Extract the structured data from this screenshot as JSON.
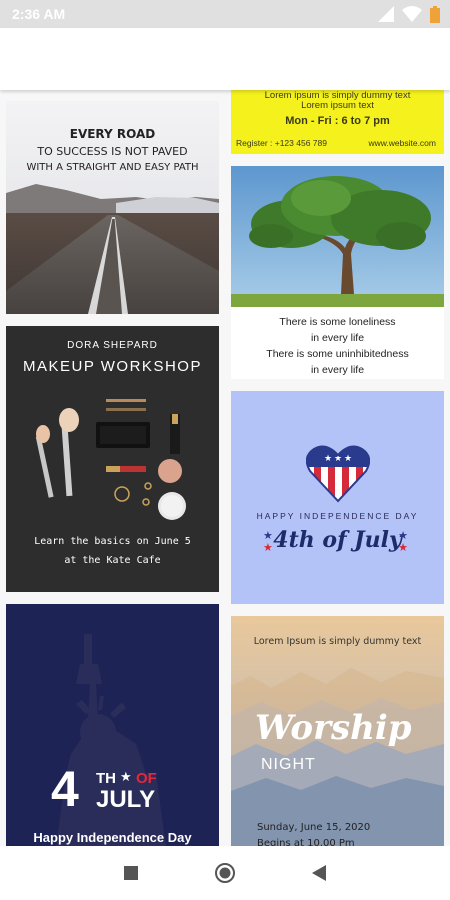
{
  "status_bar": {
    "time": "2:36 AM",
    "icons": [
      "signal-icon",
      "wifi-icon",
      "battery-icon"
    ],
    "color": "#e0e0e0"
  },
  "cards": {
    "road": {
      "line1": "EVERY ROAD",
      "line2": "TO SUCCESS IS NOT PAVED",
      "line3": "WITH A STRAIGHT AND EASY PATH"
    },
    "yellow": {
      "line1": "Lorem ipsum is simply dummy text",
      "line2": "Lorem ipsum text",
      "hours": "Mon - Fri : 6 to 7 pm",
      "register": "Register : +123 456 789",
      "website": "www.website.com"
    },
    "makeup": {
      "name": "DORA SHEPARD",
      "title": "MAKEUP WORKSHOP",
      "line1": "Learn the basics on June 5",
      "line2": "at the Kate Cafe"
    },
    "quote": {
      "line1": "There is some loneliness",
      "line2": "in every life",
      "line3": "There is some uninhibitedness",
      "line4": "in every life"
    },
    "independence": {
      "caption": "HAPPY INDEPENDENCE DAY",
      "title": "4th of July",
      "bg": "#b3c3f7"
    },
    "july": {
      "number": "4",
      "th": "TH",
      "of": "OF",
      "month": "JULY",
      "footer": "Happy Independence Day",
      "bg": "#1d2355",
      "accent": "#e2283a"
    },
    "worship": {
      "top": "Lorem Ipsum is simply dummy text",
      "title": "Worship",
      "subtitle": "NIGHT",
      "date": "Sunday, June 15, 2020",
      "time": "Begins at 10.00 Pm"
    }
  },
  "nav": {
    "items": [
      "recents-button",
      "home-button",
      "back-button"
    ]
  }
}
